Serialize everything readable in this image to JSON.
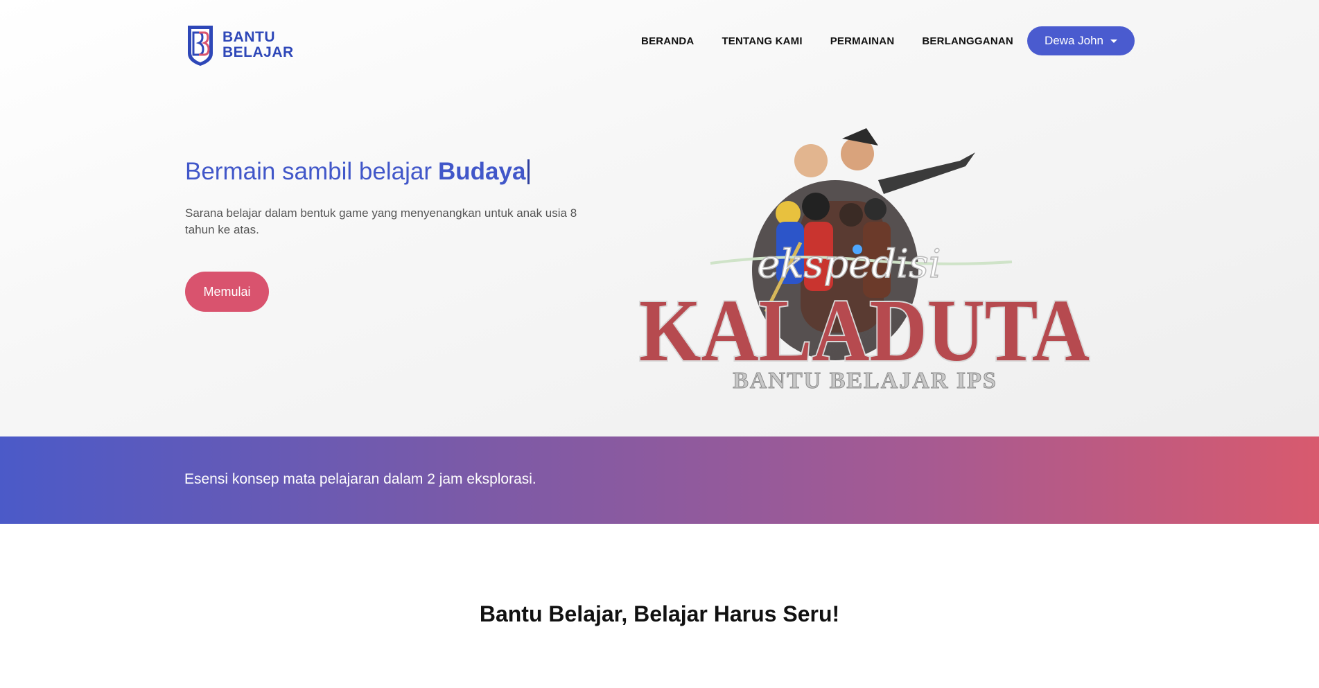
{
  "brand": {
    "line1": "BANTU",
    "line2": "BELAJAR",
    "logo_initials": "BB"
  },
  "nav": {
    "items": [
      {
        "label": "BERANDA"
      },
      {
        "label": "TENTANG KAMI"
      },
      {
        "label": "PERMAINAN"
      },
      {
        "label": "BERLANGGANAN"
      }
    ],
    "user_label": "Dewa John"
  },
  "hero": {
    "headline_prefix": "Bermain sambil belajar",
    "headline_highlight": "Budaya",
    "subtext": "Sarana belajar dalam bentuk game yang menyenangkan untuk anak usia 8 tahun ke atas.",
    "cta_label": "Memulai"
  },
  "game": {
    "script_title": "ekspedisi",
    "title": "KALADUTA",
    "subtitle": "BANTU BELAJAR IPS"
  },
  "band": {
    "text": "Esensi konsep mata pelajaran dalam 2 jam eksplorasi."
  },
  "section": {
    "title": "Bantu Belajar, Belajar Harus Seru!"
  },
  "colors": {
    "primary": "#4a5bcf",
    "accent": "#d9536e",
    "heading": "#4157c9"
  }
}
